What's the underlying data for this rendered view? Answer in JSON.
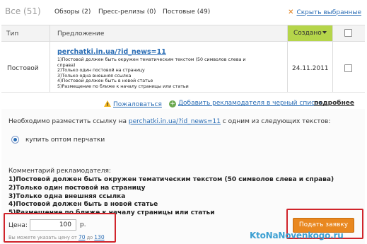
{
  "tabs": {
    "all": "Все (51)",
    "reviews": "Обзоры (2)",
    "press": "Пресс-релизы (0)",
    "posts": "Постовые (49)",
    "hide_selected": "Скрыть выбранные"
  },
  "table": {
    "headers": {
      "type": "Тип",
      "offer": "Предложение",
      "created": "Создано"
    },
    "row": {
      "type": "Постовой",
      "link": "perchatki.in.ua/?id_news=11",
      "lines": [
        "1)Постовой должен быть окружен тематическим текстом (50 символов слева и",
        "справа)",
        "2)Только один постовой на страницу",
        "3)Только одна внешняя ссылка",
        "4)Постовой должен быть в новой статье",
        "5)Размещение по ближе к началу страницы или статьи"
      ],
      "date": "24.11.2011"
    }
  },
  "actions": {
    "complain": "Пожаловаться",
    "blacklist": "Добавить рекламодателя в черный список",
    "more": "подробнее"
  },
  "instruction": {
    "before": "Необходимо разместить ссылку на ",
    "link": "perchatki.in.ua/?id_news=11",
    "after": " с одним из следующих текстов:"
  },
  "option_text": "купить оптом перчатки",
  "comment": {
    "title": "Комментарий рекламодателя:",
    "lines": [
      "1)Постовой должен быть окружен тематическим текстом (50 символов слева и справа)",
      "2)Только один постовой на страницу",
      "3)Только одна внешняя ссылка",
      "4)Постовой должен быть в новой статье",
      "5)Размещение по ближе к началу страницы или статьи"
    ]
  },
  "price": {
    "label": "Цена:",
    "value": "100",
    "unit": "р.",
    "hint_text": "Вы можете указать цену от ",
    "min": "70",
    "hint_mid": " до ",
    "max": "130"
  },
  "submit_label": "Подать заявку",
  "watermark": "KtoNaNovenkogo.ru",
  "colors": {
    "accent_green": "#b5d54a",
    "link_blue": "#2a6db5",
    "button_orange": "#e98820",
    "highlight_red": "#d0242b"
  }
}
